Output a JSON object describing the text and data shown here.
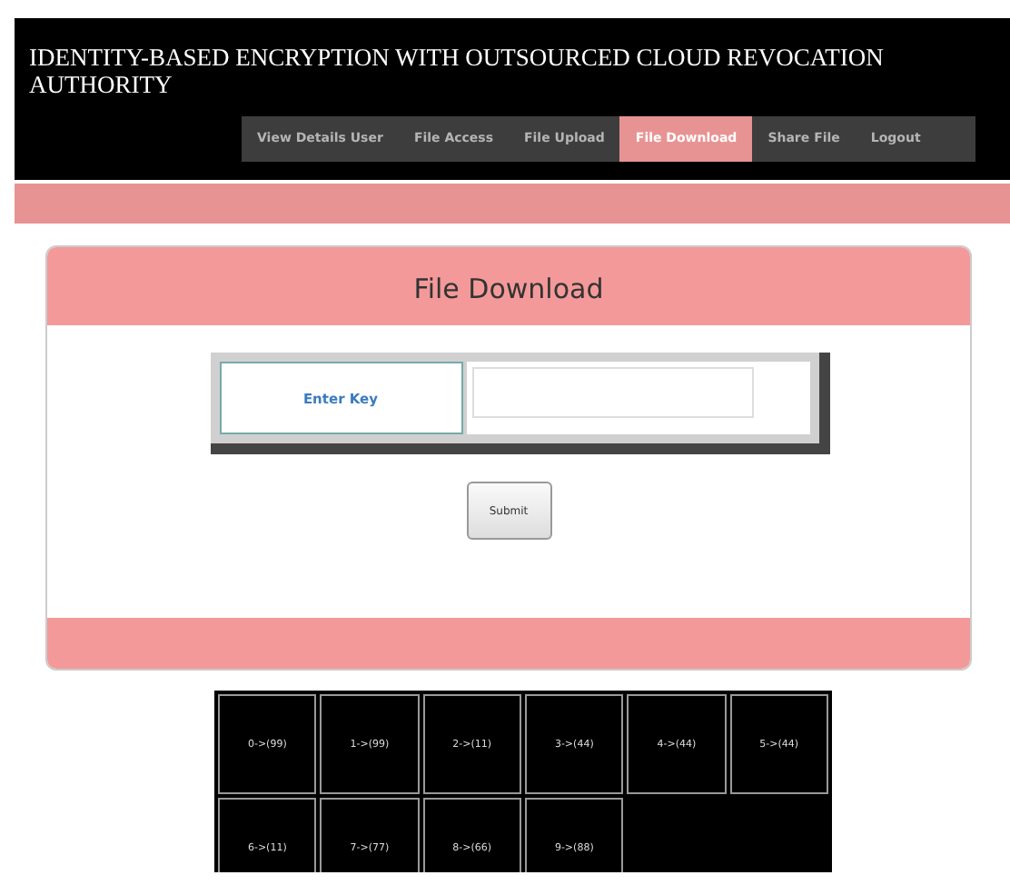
{
  "header": {
    "title": "IDENTITY-BASED ENCRYPTION WITH OUTSOURCED CLOUD REVOCATION AUTHORITY"
  },
  "nav": [
    {
      "label": "View Details User",
      "selected": false
    },
    {
      "label": "File Access",
      "selected": false
    },
    {
      "label": "File Upload",
      "selected": false
    },
    {
      "label": "File Download",
      "selected": true
    },
    {
      "label": "Share File",
      "selected": false
    },
    {
      "label": "Logout",
      "selected": false
    }
  ],
  "panel": {
    "title": "File Download",
    "form": {
      "label": "Enter Key",
      "submit": "Submit"
    }
  },
  "key_grid": [
    "0->(99)",
    "1->(99)",
    "2->(11)",
    "3->(44)",
    "4->(44)",
    "5->(44)",
    "6->(11)",
    "7->(77)",
    "8->(66)",
    "9->(88)"
  ]
}
